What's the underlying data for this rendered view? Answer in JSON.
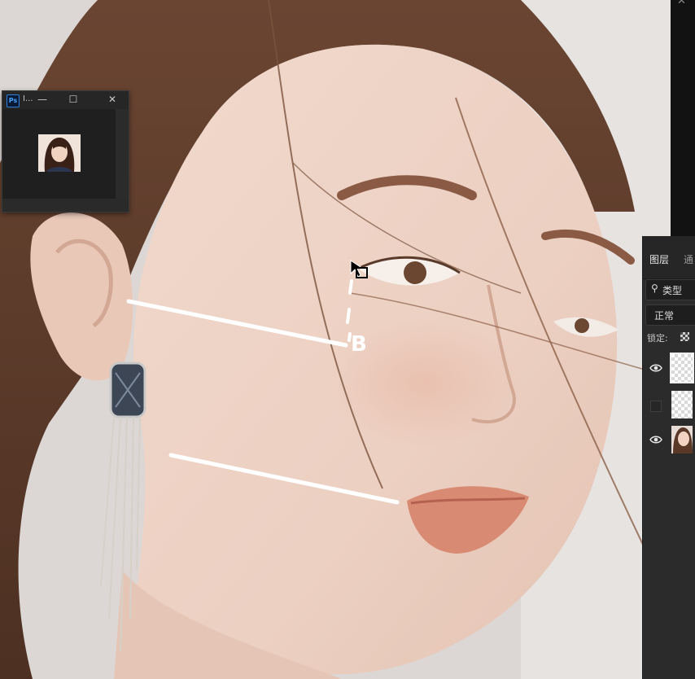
{
  "preview_window": {
    "app_icon": "Ps",
    "title": "I...",
    "buttons": {
      "minimize": "—",
      "maximize": "☐",
      "close": "✕"
    }
  },
  "layers_panel": {
    "tabs": [
      "图层",
      "通"
    ],
    "filter_kind": "类型",
    "blend_mode": "正常",
    "lock_label": "锁定:",
    "layers": [
      {
        "visible": true,
        "selected": true,
        "kind": "transparent"
      },
      {
        "visible": false,
        "selected": false,
        "kind": "transparent"
      },
      {
        "visible": true,
        "selected": false,
        "kind": "photo"
      }
    ]
  },
  "annotation": {
    "text": "B"
  },
  "colors": {
    "panel_bg": "#2b2b2b",
    "accent": "#2f7fe0"
  }
}
